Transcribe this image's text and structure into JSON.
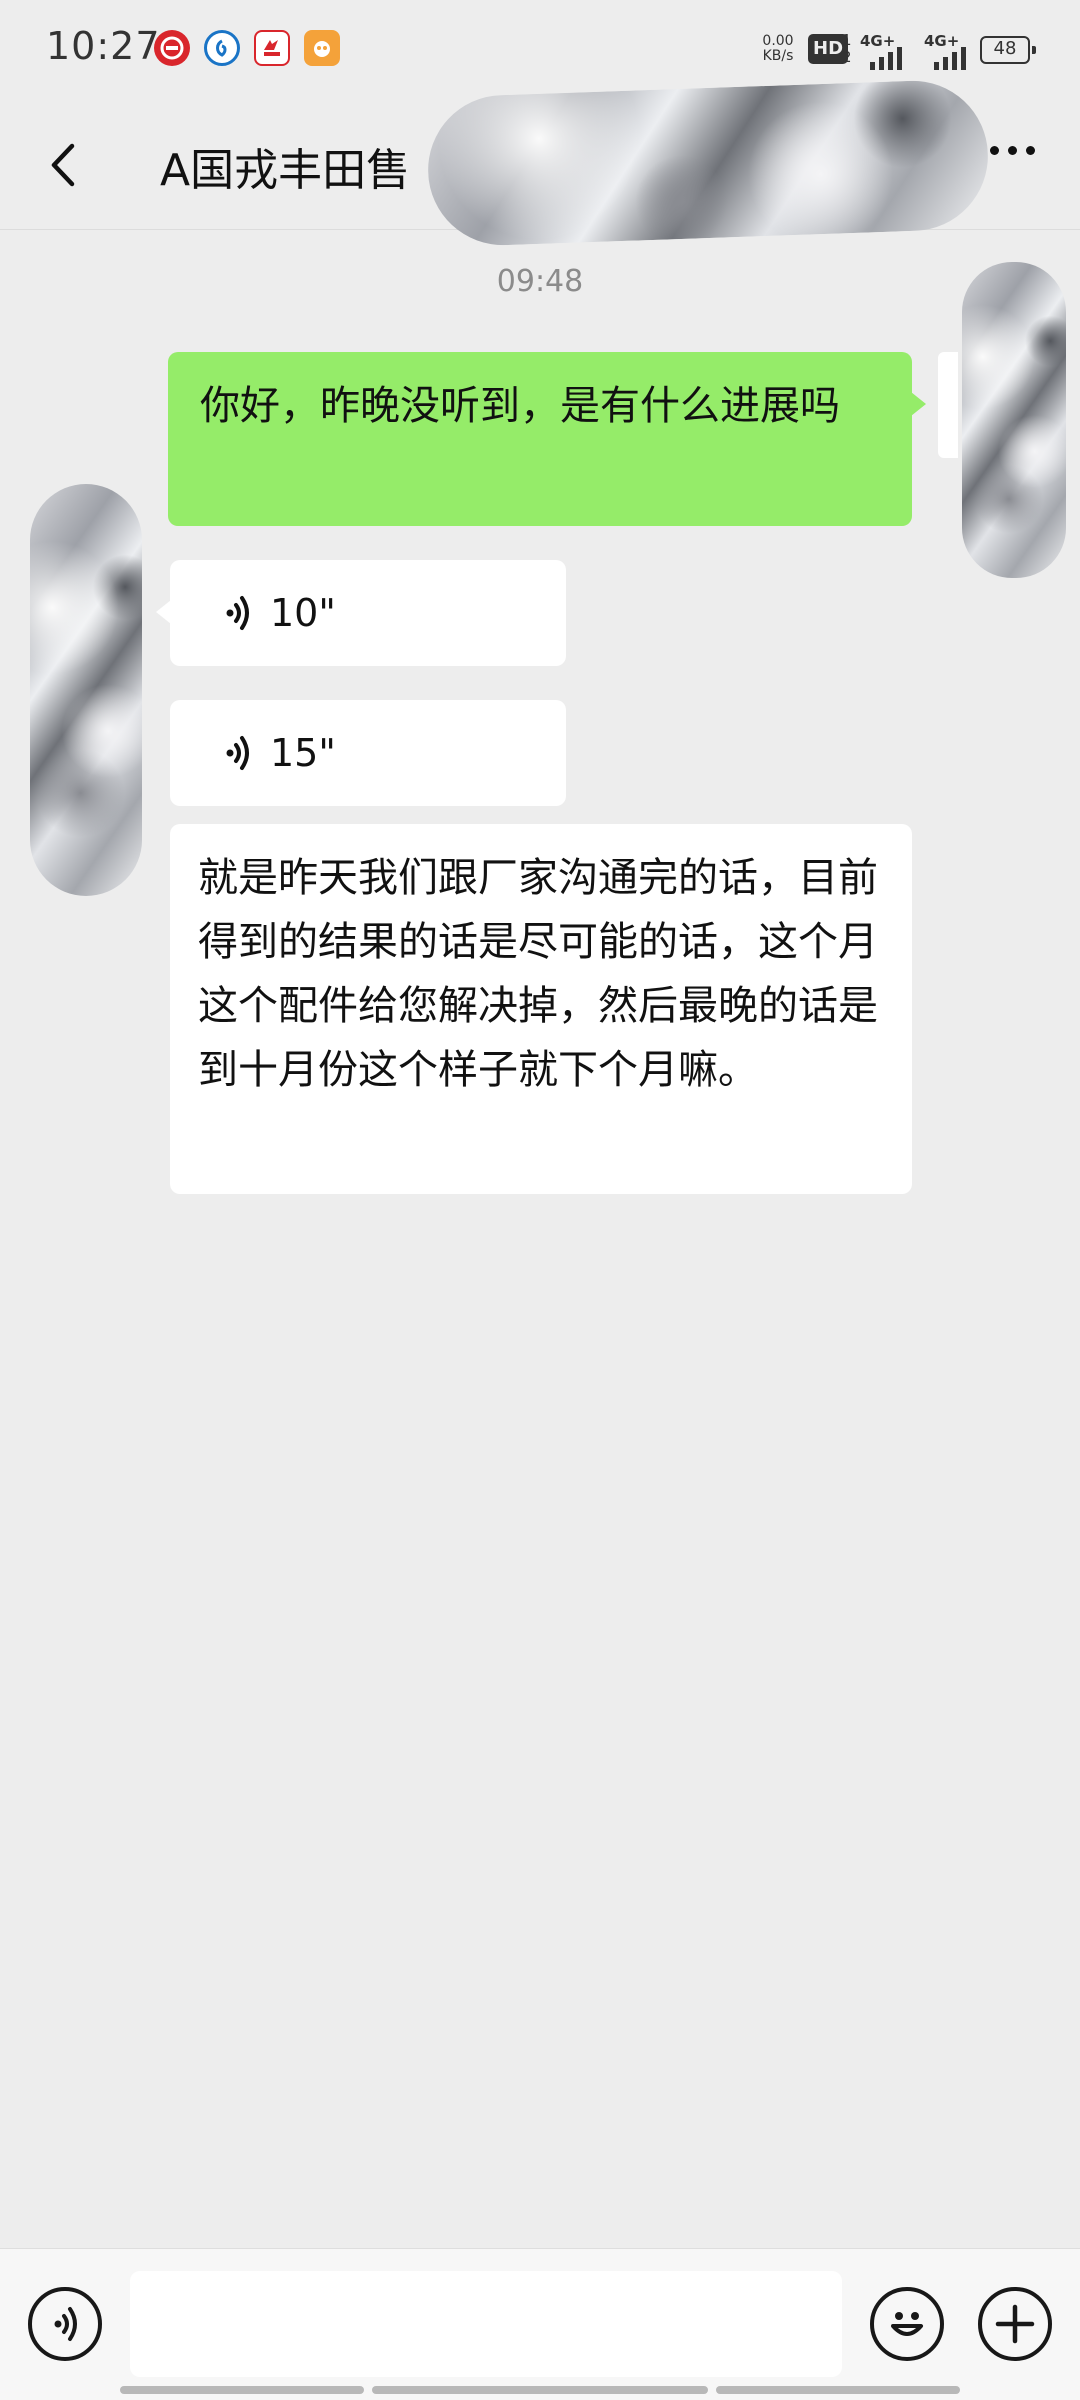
{
  "status_bar": {
    "time": "10:27",
    "notification_icons": [
      "citic-icon",
      "circle-logo-icon",
      "bank-app-icon",
      "orange-app-icon"
    ],
    "net_speed_value": "0.00",
    "net_speed_unit": "KB/s",
    "hd_label": "HD",
    "sim_slots": "1\n2",
    "signal_1_label": "4G+",
    "signal_2_label": "4G+",
    "battery": "48"
  },
  "header": {
    "title": "A国戎丰田售",
    "back_icon": "chevron-left-icon",
    "more_icon": "more-icon"
  },
  "conversation": {
    "timestamp": "09:48",
    "messages": [
      {
        "sender": "self",
        "type": "text",
        "text": "你好，昨晚没听到，是有什么进展吗"
      },
      {
        "sender": "other",
        "type": "voice",
        "duration": "10\""
      },
      {
        "sender": "other",
        "type": "voice",
        "duration": "15\""
      },
      {
        "sender": "other",
        "type": "text",
        "text": "就是昨天我们跟厂家沟通完的话，目前得到的结果的话是尽可能的话，这个月这个配件给您解决掉，然后最晚的话是到十月份这个样子就下个月嘛。"
      }
    ]
  },
  "input_bar": {
    "voice_icon": "voice-input-icon",
    "emoji_icon": "emoji-icon",
    "plus_icon": "plus-icon",
    "input_value": ""
  },
  "colors": {
    "background": "#ededed",
    "self_bubble": "#95ec69",
    "other_bubble": "#ffffff",
    "timestamp": "#8b8b8b"
  }
}
